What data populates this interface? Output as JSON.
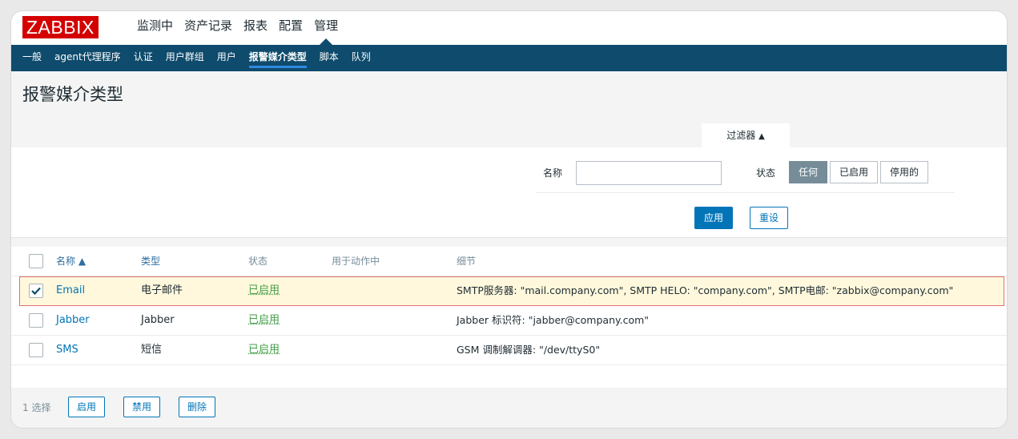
{
  "logo": "ZABBIX",
  "topmenu": [
    "监测中",
    "资产记录",
    "报表",
    "配置",
    "管理"
  ],
  "submenu": [
    "一般",
    "agent代理程序",
    "认证",
    "用户群组",
    "用户",
    "报警媒介类型",
    "脚本",
    "队列"
  ],
  "page_title": "报警媒介类型",
  "filter": {
    "tab_label": "过滤器",
    "tab_arrow": "▲",
    "name_label": "名称",
    "name_value": "",
    "status_label": "状态",
    "status_options": [
      "任何",
      "已启用",
      "停用的"
    ],
    "status_selected": "任何",
    "apply_label": "应用",
    "reset_label": "重设"
  },
  "table": {
    "headers": {
      "name": "名称 ▲",
      "type": "类型",
      "status": "状态",
      "used_in_actions": "用于动作中",
      "details": "细节"
    },
    "rows": [
      {
        "checked": true,
        "name": "Email",
        "type": "电子邮件",
        "status": "已启用",
        "used": "",
        "details": "SMTP服务器: \"mail.company.com\", SMTP HELO: \"company.com\", SMTP电邮: \"zabbix@company.com\""
      },
      {
        "checked": false,
        "name": "Jabber",
        "type": "Jabber",
        "status": "已启用",
        "used": "",
        "details": "Jabber 标识符: \"jabber@company.com\""
      },
      {
        "checked": false,
        "name": "SMS",
        "type": "短信",
        "status": "已启用",
        "used": "",
        "details": "GSM 调制解调器: \"/dev/ttyS0\""
      }
    ]
  },
  "bottom": {
    "selected_count": "1 选择",
    "enable_label": "启用",
    "disable_label": "禁用",
    "delete_label": "删除"
  },
  "colors": {
    "brand": "#d40000",
    "nav": "#0e4b6c",
    "accent": "#0275b8",
    "enabled": "#429e47"
  }
}
